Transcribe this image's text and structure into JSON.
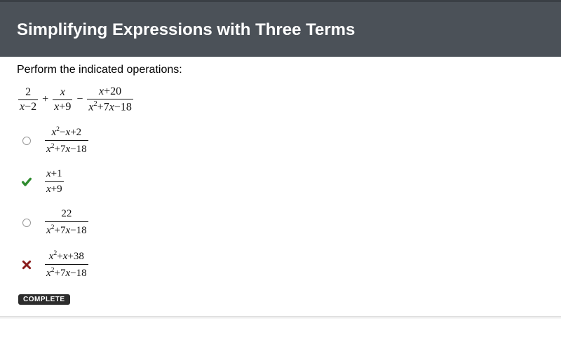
{
  "header": {
    "title": "Simplifying Expressions with Three Terms"
  },
  "prompt": "Perform the indicated operations:",
  "expression": {
    "term1": {
      "num": "2",
      "den_lhs": "x",
      "den_rhs": "2",
      "den_sign": "−"
    },
    "op1": "+",
    "term2": {
      "num": "x",
      "den_lhs": "x",
      "den_rhs": "9",
      "den_sign": "+"
    },
    "op2": "−",
    "term3": {
      "num_lhs": "x",
      "num_rhs": "20",
      "num_sign": "+",
      "den": "x² + 7x − 18"
    }
  },
  "options": [
    {
      "status": "empty",
      "num": "x² − x + 2",
      "den": "x² + 7x − 18"
    },
    {
      "status": "correct",
      "num": "x + 1",
      "den": "x + 9"
    },
    {
      "status": "empty",
      "num": "22",
      "den": "x² + 7x − 18"
    },
    {
      "status": "wrong",
      "num": "x² + x + 38",
      "den": "x² + 7x − 18"
    }
  ],
  "labels": {
    "complete": "COMPLETE"
  },
  "glyphs": {
    "x": "x",
    "plus": "+",
    "minus": "−",
    "sq": "2"
  }
}
